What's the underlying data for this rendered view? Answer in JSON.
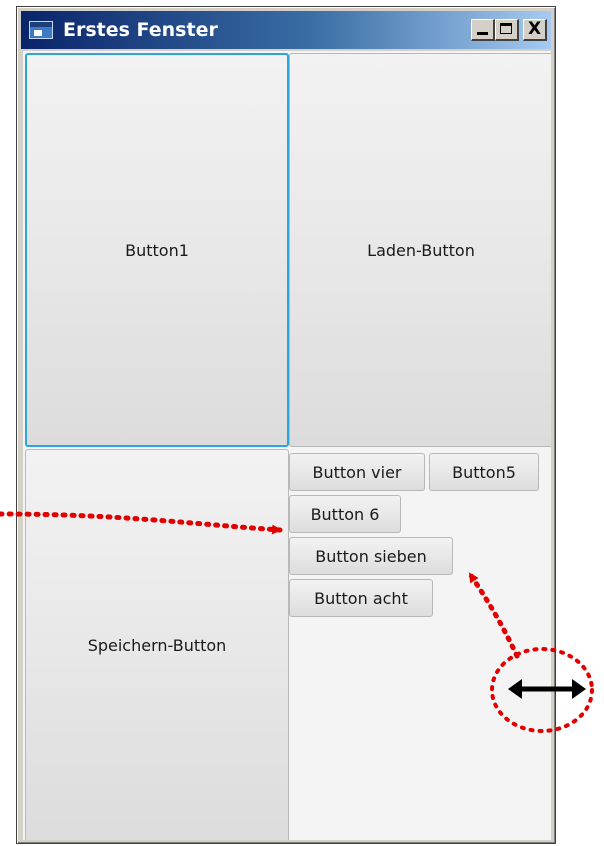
{
  "window": {
    "title": "Erstes Fenster",
    "caption_buttons": {
      "minimize": "_",
      "maximize": "□",
      "close": "X"
    }
  },
  "buttons": {
    "button1": "Button1",
    "laden": "Laden-Button",
    "speichern": "Speichern-Button",
    "vier": "Button vier",
    "five": "Button5",
    "six": "Button 6",
    "sieben": "Button sieben",
    "acht": "Button acht"
  },
  "focused_button": "Button1",
  "colors": {
    "focus_border": "#2aa6dc",
    "annotation": "#e00000",
    "titlebar_start": "#0a246a",
    "titlebar_end": "#a6caf0"
  },
  "icons": {
    "app": "window-app-icon",
    "resize": "horizontal-resize-cursor-icon"
  }
}
